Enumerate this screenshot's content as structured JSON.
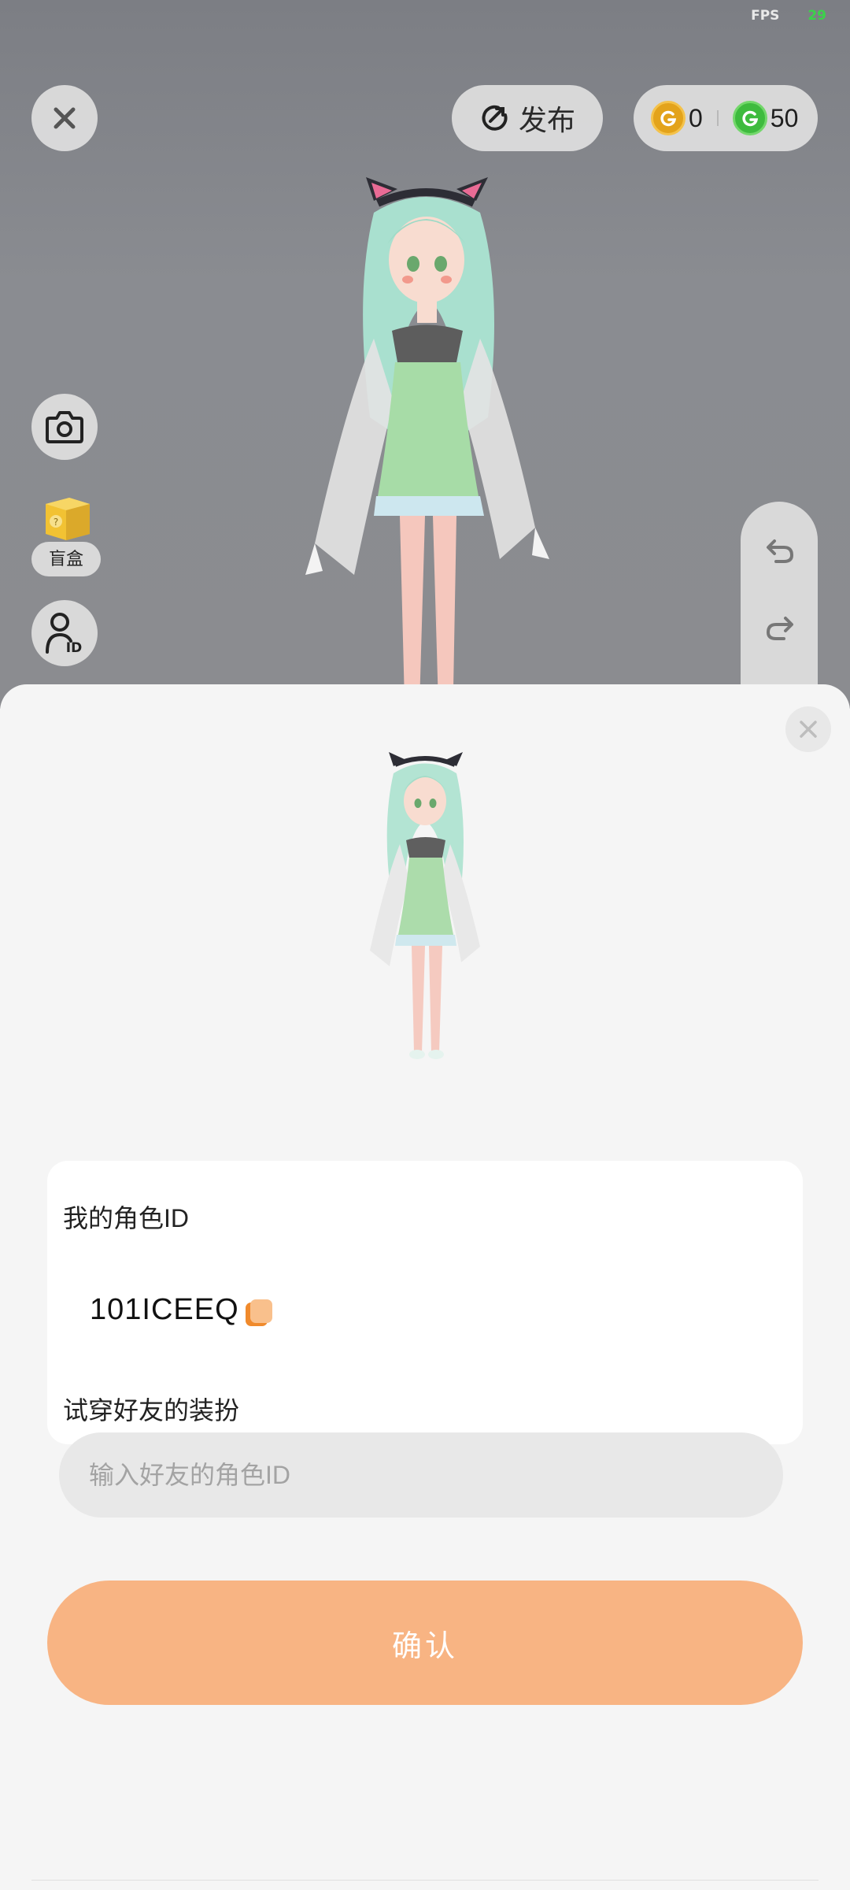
{
  "status": {
    "fps_label": "FPS",
    "fps_value": "29"
  },
  "top_bar": {
    "publish_label": "发布",
    "gold_coin": "0",
    "green_coin": "50"
  },
  "left_tools": {
    "blind_box_label": "盲盒"
  },
  "sheet": {
    "my_id_title": "我的角色ID",
    "my_id_value": "101ICEEQ",
    "try_on_title": "试穿好友的装扮",
    "friend_id_placeholder": "输入好友的角色ID",
    "confirm_label": "确认"
  },
  "colors": {
    "accent": "#f8b483",
    "gold": "#e3a31b",
    "green": "#3ebb3e",
    "fps_green": "#3bd24a"
  },
  "icons": [
    "close-icon",
    "publish-icon",
    "gold-coin-icon",
    "green-coin-icon",
    "camera-icon",
    "blind-box-icon",
    "role-id-icon",
    "undo-icon",
    "redo-icon",
    "copy-icon"
  ]
}
